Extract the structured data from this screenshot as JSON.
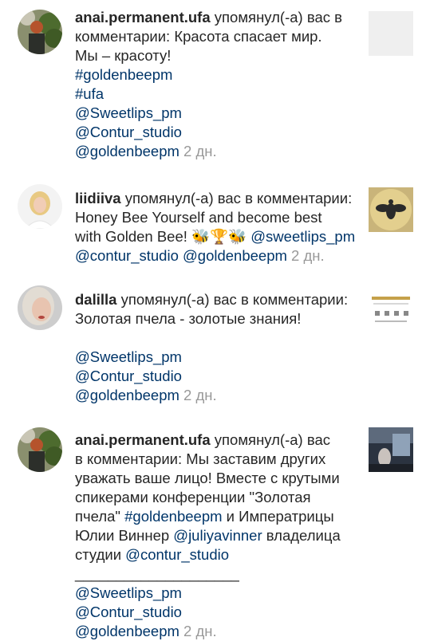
{
  "notifications": [
    {
      "username": "anai.permanent.ufa",
      "line1_rest": " упомянул(-а) вас в",
      "line2": "комментарии: Красота спасает мир.",
      "line3": "Мы – красоту!",
      "tag1": "#goldenbeepm",
      "tag2": "#ufa",
      "mention1": "@Sweetlips_pm",
      "mention2": "@Contur_studio",
      "mention3": "@goldenbeepm",
      "time": "2 дн."
    },
    {
      "username": "liidiiva",
      "line1_rest": " упомянул(-а) вас в комментарии:",
      "line2": "Honey Bee Yourself and become best",
      "line3_text": "with Golden Bee! ",
      "emoji": "🐝🏆🐝",
      "mention1": "@sweetlips_pm",
      "mention2": "@contur_studio",
      "mention3": "@goldenbeepm",
      "time": "2 дн."
    },
    {
      "username": "dalilla",
      "line1_rest": " упомянул(-а) вас в комментарии:",
      "line2": "Золотая пчела - золотые знания!",
      "mention1": "@Sweetlips_pm",
      "mention2": "@Contur_studio",
      "mention3": "@goldenbeepm",
      "time": "2 дн."
    },
    {
      "username": "anai.permanent.ufa",
      "line1_rest": " упомянул(-а) вас",
      "line2": "в комментарии: Мы заставим других",
      "line3": "уважать ваше лицо! Вместе с крутыми",
      "line4": "спикерами конференции \"Золотая",
      "line5_text": "пчела\" ",
      "line5_tag": "#goldenbeepm",
      "line5_rest": "  и Императрицы",
      "line6_text": "Юлии Виннер ",
      "line6_mention": "@juliyavinner",
      "line6_rest": " владелица",
      "line7_text": "студии ",
      "line7_mention": "@contur_studio",
      "divider": "____________________",
      "mention1": "@Sweetlips_pm",
      "mention2": "@Contur_studio",
      "mention3": "@goldenbeepm",
      "time": "2 дн."
    }
  ],
  "icons": {
    "avatar1": "woman-with-plant-avatar",
    "avatar2": "blonde-woman-avatar",
    "avatar3": "blonde-woman-portrait-avatar",
    "thumb1": "blank-post-thumbnail",
    "thumb2": "golden-bee-logo-thumbnail",
    "thumb3": "golden-bee-poster-thumbnail",
    "thumb4": "conference-photo-thumbnail"
  },
  "colors": {
    "text": "#262626",
    "link": "#003569",
    "time": "#999999"
  }
}
